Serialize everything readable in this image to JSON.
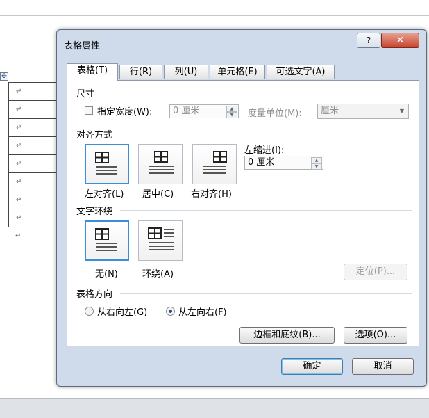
{
  "document": {
    "move_handle": "✣",
    "para_mark": "↵",
    "rows": [
      "↵",
      "↵",
      "↵",
      "↵",
      "↵",
      "↵",
      "↵",
      "↵"
    ]
  },
  "dialog": {
    "title": "表格属性",
    "help_label": "?",
    "close_label": "✕",
    "tabs": [
      {
        "label": "表格(T)"
      },
      {
        "label": "行(R)"
      },
      {
        "label": "列(U)"
      },
      {
        "label": "单元格(E)"
      },
      {
        "label": "可选文字(A)"
      }
    ],
    "size": {
      "section": "尺寸",
      "specify_width_label": "指定宽度(W):",
      "specify_width_checked": false,
      "width_value": "0 厘米",
      "unit_label": "度量单位(M):",
      "unit_value": "厘米"
    },
    "alignment": {
      "section": "对齐方式",
      "options": [
        {
          "label": "左对齐(L)",
          "selected": true,
          "icon": "align-left-icon"
        },
        {
          "label": "居中(C)",
          "selected": false,
          "icon": "align-center-icon"
        },
        {
          "label": "右对齐(H)",
          "selected": false,
          "icon": "align-right-icon"
        }
      ],
      "indent_label": "左缩进(I):",
      "indent_value": "0 厘米"
    },
    "wrapping": {
      "section": "文字环绕",
      "options": [
        {
          "label": "无(N)",
          "selected": true,
          "icon": "wrap-none-icon"
        },
        {
          "label": "环绕(A)",
          "selected": false,
          "icon": "wrap-around-icon"
        }
      ],
      "positioning_button": "定位(P)..."
    },
    "direction": {
      "section": "表格方向",
      "options": [
        {
          "label": "从右向左(G)",
          "selected": false
        },
        {
          "label": "从左向右(F)",
          "selected": true
        }
      ]
    },
    "borders_button": "边框和底纹(B)...",
    "options_button": "选项(O)...",
    "ok_button": "确定",
    "cancel_button": "取消"
  },
  "colors": {
    "dialog_bg": "#cfdaea",
    "selected_border": "#3b8fd9",
    "close_button": "#c8432e"
  }
}
